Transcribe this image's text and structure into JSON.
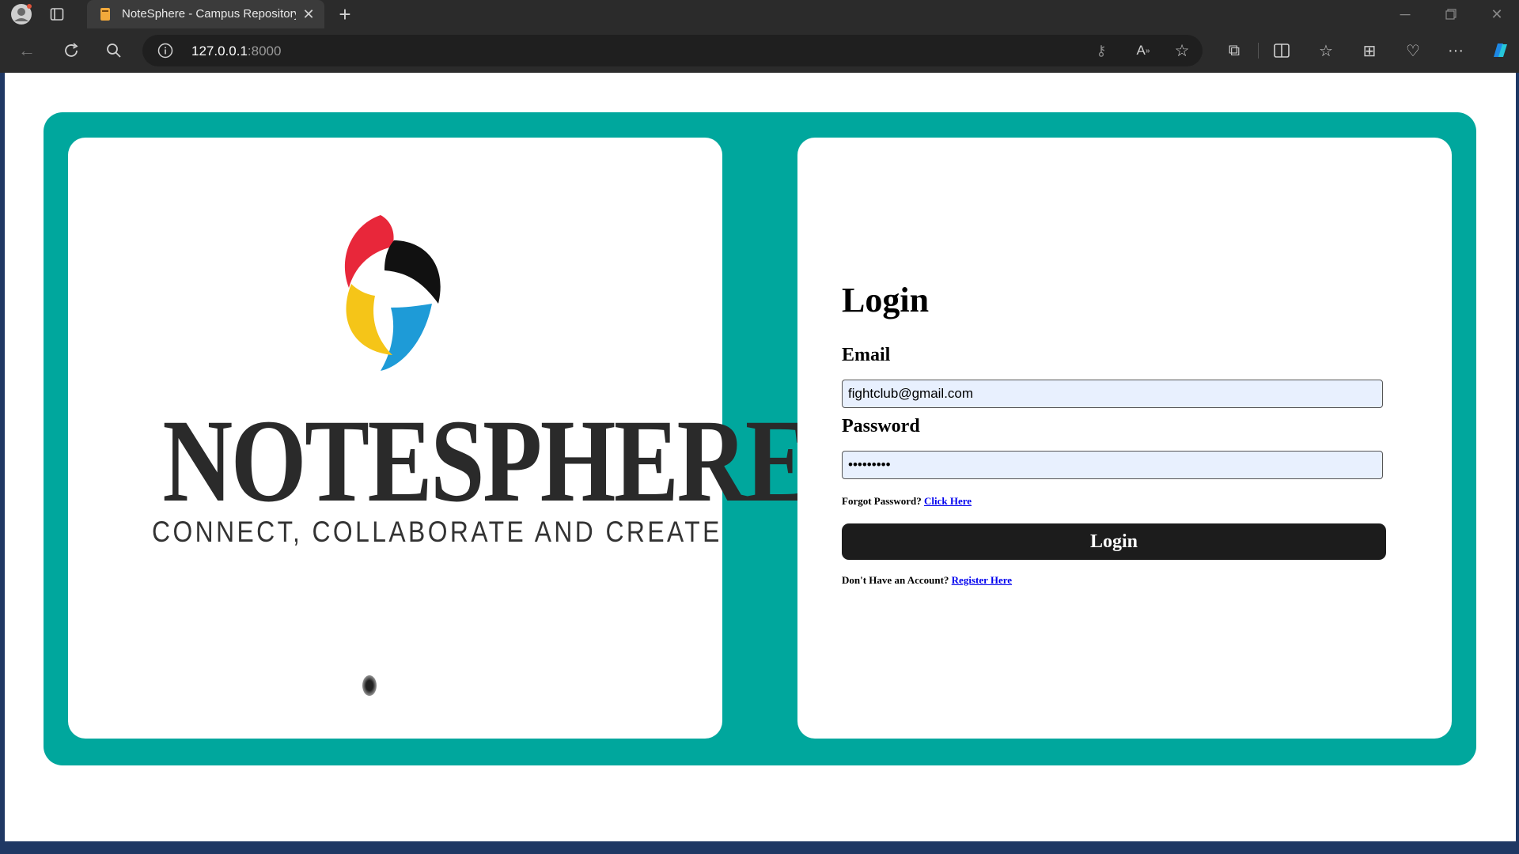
{
  "browser": {
    "tab_title": "NoteSphere - Campus Repository",
    "url_host": "127.0.0.1",
    "url_port": ":8000",
    "icons": [
      "profile-icon",
      "tab-actions-icon",
      "tab-favicon",
      "close-icon",
      "new-tab-icon",
      "minimize-icon",
      "restore-icon",
      "window-close-icon",
      "back-icon",
      "refresh-icon",
      "search-icon",
      "site-info-icon",
      "password-icon",
      "read-aloud-icon",
      "favorite-star-icon",
      "extensions-icon",
      "split-screen-icon",
      "favorites-icon",
      "collections-icon",
      "browser-essentials-icon",
      "more-icon",
      "copilot-icon"
    ]
  },
  "brand": {
    "name": "NOTESPHERE",
    "tagline": "CONNECT, COLLABORATE AND CREATE",
    "colors": {
      "red": "#e8273a",
      "black": "#111111",
      "blue": "#1e9bd7",
      "yellow": "#f5c518"
    }
  },
  "login": {
    "heading": "Login",
    "email_label": "Email",
    "email_value": "fightclub@gmail.com",
    "password_label": "Password",
    "password_value": "password1",
    "forgot_text": "Forgot Password?",
    "forgot_link": "Click Here",
    "button_label": "Login",
    "register_text": "Don't Have an Account?",
    "register_link": "Register Here"
  },
  "colors": {
    "accent": "#00a79d",
    "button": "#1c1c1c",
    "input_bg": "#e8f0fe"
  }
}
